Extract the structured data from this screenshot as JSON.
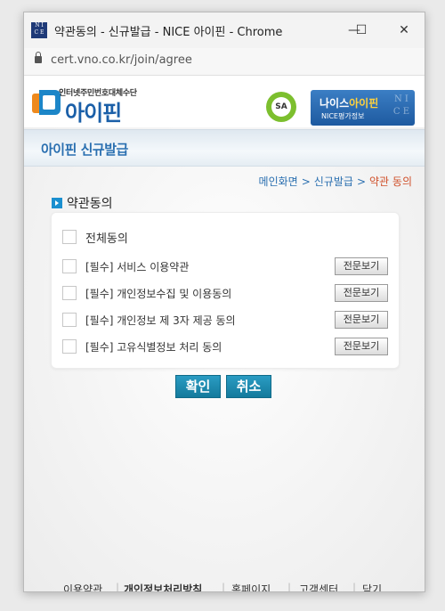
{
  "window": {
    "title": "약관동의 - 신규발급 - NICE 아이핀 - Chrome",
    "url": "cert.vno.co.kr/join/agree",
    "favicon_letters": [
      "N I",
      "C E"
    ],
    "controls": {
      "minimize": "—",
      "maximize": "☐",
      "close": "✕"
    }
  },
  "header": {
    "logo_sub": "인터넷주민번호대체수단",
    "logo_text": "아이핀",
    "sa_badge": "SA",
    "nice_brand_prefix": "나이스",
    "nice_brand_highlight": "아이핀",
    "nice_sub": "NICE평가정보",
    "nice_watermark": [
      "N I",
      "C E"
    ]
  },
  "banner": {
    "title": "아이핀 신규발급"
  },
  "breadcrumb": {
    "home": "메인화면",
    "issue": "신규발급",
    "current": "약관 동의",
    "separator": ">"
  },
  "section": {
    "title": "약관동의"
  },
  "agreements": {
    "all_label": "전체동의",
    "items": [
      {
        "label": "[필수] 서비스 이용약관",
        "button": "전문보기"
      },
      {
        "label": "[필수] 개인정보수집 및 이용동의",
        "button": "전문보기"
      },
      {
        "label": "[필수] 개인정보 제 3자 제공 동의",
        "button": "전문보기"
      },
      {
        "label": "[필수] 고유식별정보 처리 동의",
        "button": "전문보기"
      }
    ]
  },
  "actions": {
    "confirm": "확인",
    "cancel": "취소"
  },
  "footer": {
    "links": [
      "이용약관",
      "개인정보처리방침",
      "홈페이지",
      "고객센터",
      "닫기"
    ],
    "separator": "|"
  },
  "colors": {
    "accent": "#1a8fcf",
    "brand_blue": "#2a6fb0",
    "current_crumb": "#d0502a",
    "button": "#147a9c"
  }
}
